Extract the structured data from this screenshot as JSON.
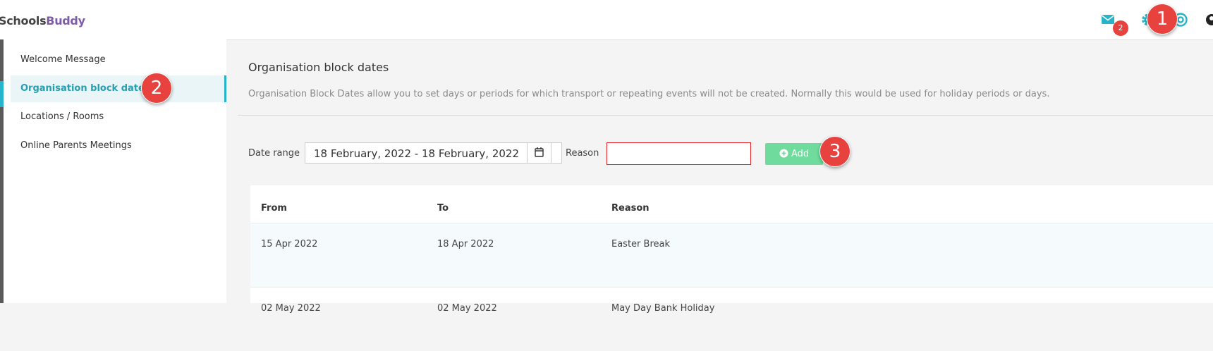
{
  "app": {
    "logo_part1": "Schools",
    "logo_part2": "Buddy"
  },
  "header": {
    "mail_badge": "2",
    "icons": [
      "envelope-icon",
      "gear-icon",
      "help-icon",
      "user-icon"
    ]
  },
  "callouts": {
    "c1": "1",
    "c2": "2",
    "c3": "3"
  },
  "sidebar": {
    "items": [
      {
        "label": "Welcome Message"
      },
      {
        "label": "Organisation block dates"
      },
      {
        "label": "Locations / Rooms"
      },
      {
        "label": "Online Parents Meetings"
      }
    ]
  },
  "main": {
    "title": "Organisation block dates",
    "description": "Organisation Block Dates allow you to set days or periods for which transport or repeating events will not be created. Normally this would be used for holiday periods or days.",
    "date_range_label": "Date range",
    "date_range_value": "18 February, 2022 - 18 February, 2022",
    "reason_label": "Reason",
    "reason_value": "",
    "add_label": "Add"
  },
  "table": {
    "headers": {
      "from": "From",
      "to": "To",
      "reason": "Reason"
    },
    "rows": [
      {
        "from": "15 Apr 2022",
        "to": "18 Apr 2022",
        "reason": "Easter Break"
      },
      {
        "from": "02 May 2022",
        "to": "02 May 2022",
        "reason": "May Day Bank Holiday"
      }
    ]
  },
  "colors": {
    "accent": "#27b3c9",
    "brand": "#7e5aa8",
    "callout": "#e8423f",
    "add_button": "#6fdb9c",
    "error_border": "#e02020"
  }
}
